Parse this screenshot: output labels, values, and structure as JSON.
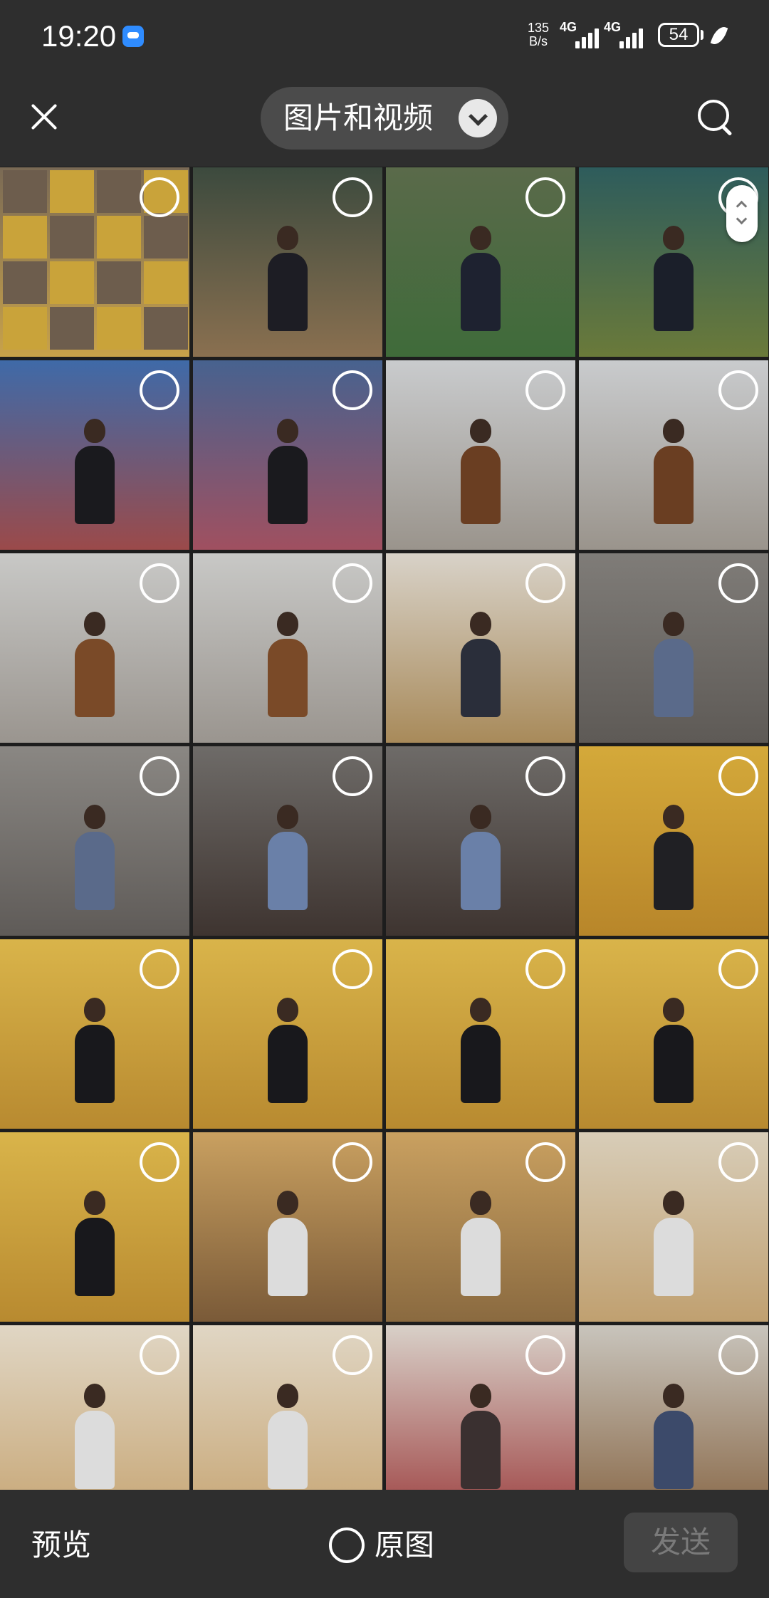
{
  "status_bar": {
    "time": "19:20",
    "net_speed_value": "135",
    "net_speed_unit": "B/s",
    "sim1_network": "4G",
    "sim2_network": "4G",
    "battery": "54",
    "message_icon": "chat-bubble-icon",
    "leaf_icon": "leaf-icon"
  },
  "header": {
    "close_icon": "close-icon",
    "album_title": "图片和视频",
    "dropdown_icon": "chevron-down-icon",
    "search_icon": "search-icon"
  },
  "footer": {
    "preview_label": "预览",
    "original_label": "原图",
    "original_checked": false,
    "send_label": "发送",
    "send_enabled": false
  },
  "photos": [
    {
      "bg": [
        "#7a6a55",
        "#c8a24a"
      ],
      "figure": "#2a2a2a",
      "collage": true
    },
    {
      "bg": [
        "#3c4a3e",
        "#8a7050"
      ],
      "figure": "#1d1d24"
    },
    {
      "bg": [
        "#5a6a4a",
        "#3f6b3a"
      ],
      "figure": "#1e2230"
    },
    {
      "bg": [
        "#2e5c5c",
        "#6a7a3a"
      ],
      "figure": "#1b1f2a"
    },
    {
      "bg": [
        "#3f6aa8",
        "#9b4a4a"
      ],
      "figure": "#1a1a1e"
    },
    {
      "bg": [
        "#47628f",
        "#a05060"
      ],
      "figure": "#1a1a1e"
    },
    {
      "bg": [
        "#c9cbcd",
        "#9a948c"
      ],
      "figure": "#6a3e22"
    },
    {
      "bg": [
        "#c9cbcd",
        "#9a948c"
      ],
      "figure": "#6a3e22"
    },
    {
      "bg": [
        "#c8c8c6",
        "#9a958f"
      ],
      "figure": "#7a4a28"
    },
    {
      "bg": [
        "#c8c8c6",
        "#9a958f"
      ],
      "figure": "#7a4a28"
    },
    {
      "bg": [
        "#d8d2c8",
        "#a88a5a"
      ],
      "figure": "#2a2e3a"
    },
    {
      "bg": [
        "#7f7c78",
        "#5e5a56"
      ],
      "figure": "#5a6a8a"
    },
    {
      "bg": [
        "#8a8783",
        "#5f5b58"
      ],
      "figure": "#5a6a8a"
    },
    {
      "bg": [
        "#6e6b68",
        "#3e3430"
      ],
      "figure": "#6a80a8"
    },
    {
      "bg": [
        "#6e6b68",
        "#3e3430"
      ],
      "figure": "#6a80a8"
    },
    {
      "bg": [
        "#d4a93a",
        "#b8862a"
      ],
      "figure": "#202024"
    },
    {
      "bg": [
        "#d9b44a",
        "#b88a30"
      ],
      "figure": "#18181c"
    },
    {
      "bg": [
        "#d9b44a",
        "#b88a30"
      ],
      "figure": "#18181c"
    },
    {
      "bg": [
        "#d9b44a",
        "#b88a30"
      ],
      "figure": "#18181c"
    },
    {
      "bg": [
        "#d9b44a",
        "#b88a30"
      ],
      "figure": "#18181c"
    },
    {
      "bg": [
        "#d9b44a",
        "#b88a30"
      ],
      "figure": "#18181c"
    },
    {
      "bg": [
        "#c9a060",
        "#7a5a38"
      ],
      "figure": "#dcdcdc"
    },
    {
      "bg": [
        "#c9a060",
        "#8a6a40"
      ],
      "figure": "#dcdcdc"
    },
    {
      "bg": [
        "#d8cdb8",
        "#c0a070"
      ],
      "figure": "#dcdcdc"
    },
    {
      "bg": [
        "#e0d6c4",
        "#c8a878"
      ],
      "figure": "#dcdcdc"
    },
    {
      "bg": [
        "#e0d6c4",
        "#c8a878"
      ],
      "figure": "#dcdcdc"
    },
    {
      "bg": [
        "#d8d0c8",
        "#a04848"
      ],
      "figure": "#3a3030"
    },
    {
      "bg": [
        "#c8c4bc",
        "#8a6a4a"
      ],
      "figure": "#3c4a6a"
    }
  ]
}
